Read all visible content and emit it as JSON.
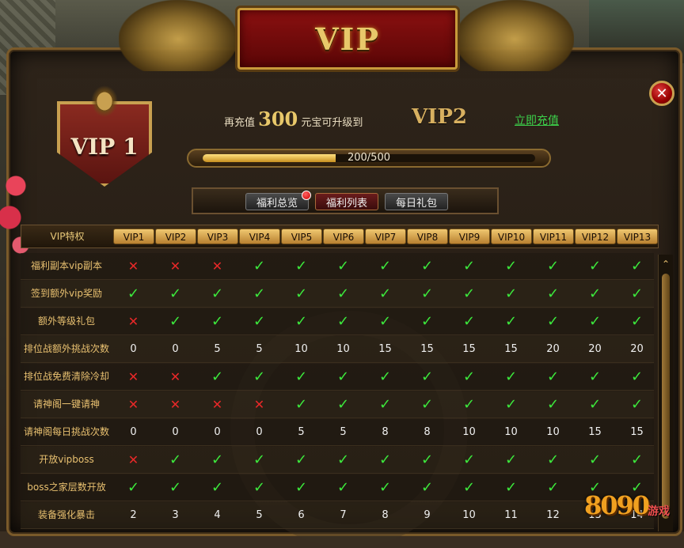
{
  "title": "VIP",
  "current_vip": "VIP 1",
  "recharge": {
    "prefix": "再充值",
    "amount": "300",
    "suffix": "元宝可升级到",
    "next_vip": "VIP2",
    "link": "立即充值"
  },
  "progress": {
    "text": "200/500",
    "current": 200,
    "max": 500
  },
  "tabs": [
    {
      "label": "福利总览",
      "active": false,
      "has_dot": true
    },
    {
      "label": "福利列表",
      "active": true,
      "has_dot": false
    },
    {
      "label": "每日礼包",
      "active": false,
      "has_dot": false
    }
  ],
  "table": {
    "privilege_header": "VIP特权",
    "levels": [
      "VIP1",
      "VIP2",
      "VIP3",
      "VIP4",
      "VIP5",
      "VIP6",
      "VIP7",
      "VIP8",
      "VIP9",
      "VIP10",
      "VIP11",
      "VIP12",
      "VIP13"
    ],
    "rows": [
      {
        "label": "福利副本vip副本",
        "values": [
          "x",
          "x",
          "x",
          "v",
          "v",
          "v",
          "v",
          "v",
          "v",
          "v",
          "v",
          "v",
          "v"
        ]
      },
      {
        "label": "签到额外vip奖励",
        "values": [
          "v",
          "v",
          "v",
          "v",
          "v",
          "v",
          "v",
          "v",
          "v",
          "v",
          "v",
          "v",
          "v"
        ]
      },
      {
        "label": "额外等级礼包",
        "values": [
          "x",
          "v",
          "v",
          "v",
          "v",
          "v",
          "v",
          "v",
          "v",
          "v",
          "v",
          "v",
          "v"
        ]
      },
      {
        "label": "排位战额外挑战次数",
        "values": [
          "0",
          "0",
          "5",
          "5",
          "10",
          "10",
          "15",
          "15",
          "15",
          "15",
          "20",
          "20",
          "20"
        ]
      },
      {
        "label": "排位战免费清除冷却",
        "values": [
          "x",
          "x",
          "v",
          "v",
          "v",
          "v",
          "v",
          "v",
          "v",
          "v",
          "v",
          "v",
          "v"
        ]
      },
      {
        "label": "请神阁一键请神",
        "values": [
          "x",
          "x",
          "x",
          "x",
          "v",
          "v",
          "v",
          "v",
          "v",
          "v",
          "v",
          "v",
          "v"
        ]
      },
      {
        "label": "请神阁每日挑战次数",
        "values": [
          "0",
          "0",
          "0",
          "0",
          "5",
          "5",
          "8",
          "8",
          "10",
          "10",
          "10",
          "15",
          "15"
        ]
      },
      {
        "label": "开放vipboss",
        "values": [
          "x",
          "v",
          "v",
          "v",
          "v",
          "v",
          "v",
          "v",
          "v",
          "v",
          "v",
          "v",
          "v"
        ]
      },
      {
        "label": "boss之家层数开放",
        "values": [
          "v",
          "v",
          "v",
          "v",
          "v",
          "v",
          "v",
          "v",
          "v",
          "v",
          "v",
          "v",
          "v"
        ]
      },
      {
        "label": "装备强化暴击",
        "values": [
          "2",
          "3",
          "4",
          "5",
          "6",
          "7",
          "8",
          "9",
          "10",
          "11",
          "12",
          "13",
          "14"
        ]
      }
    ]
  },
  "symbols": {
    "yes": "✓",
    "no": "✕",
    "close": "✕",
    "scroll_up": "⌃"
  },
  "logo": {
    "number": "8090",
    "text": "游戏"
  },
  "colors": {
    "yes": "#3ce83c",
    "no": "#e82828",
    "gold": "#e8c86a",
    "link": "#3cd04a"
  }
}
